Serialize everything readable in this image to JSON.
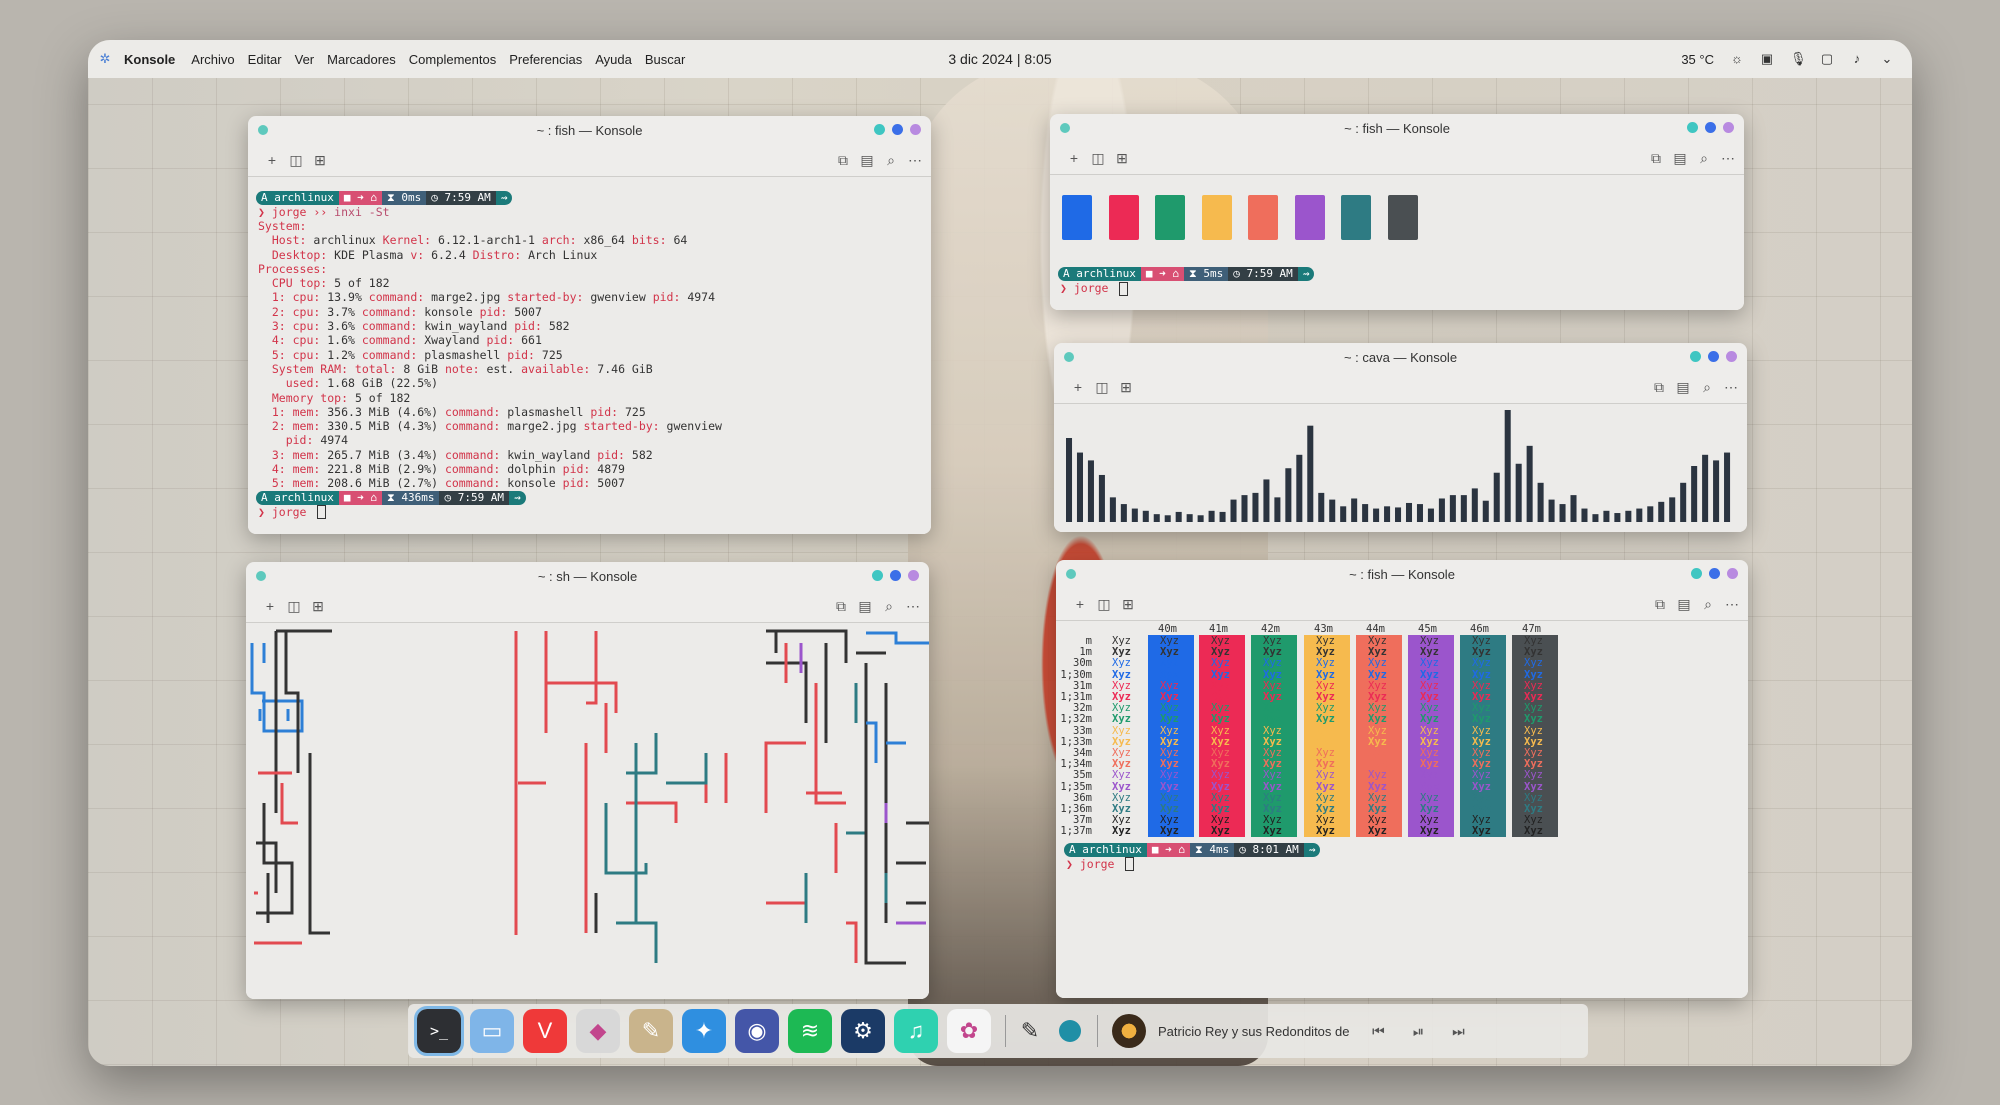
{
  "panel": {
    "app_name": "Konsole",
    "menu": [
      "Archivo",
      "Editar",
      "Ver",
      "Marcadores",
      "Complementos",
      "Preferencias",
      "Ayuda",
      "Buscar"
    ],
    "clock": "3 dic 2024 | 8:05",
    "temperature": "35 °C",
    "tray_icons": [
      "brightness-icon",
      "clipboard-icon",
      "microphone-icon",
      "display-icon",
      "volume-icon",
      "chevron-down-icon"
    ]
  },
  "colors": {
    "blue": "#1f6ae6",
    "red": "#ec2a55",
    "green": "#1f9a6c",
    "yellow": "#f6ba4e",
    "orange": "#ef6e5c",
    "purple": "#9b55cc",
    "teal": "#2e7b83",
    "dark": "#4a4f52",
    "prompt_teal": "#1b7a7a",
    "prompt_dark": "#333f45",
    "prompt_pink": "#d84f73",
    "prompt_blue": "#3f5f78"
  },
  "win1": {
    "title": "~ : fish — Konsole",
    "prompt1": {
      "host": "archlinux",
      "time": "0ms",
      "clock": "7:59 AM"
    },
    "user": "jorge",
    "command": "inxi -St",
    "lines": [
      [
        "System:",
        ""
      ],
      [
        "  Host: ",
        "archlinux ",
        "Kernel: ",
        "6.12.1-arch1-1 ",
        "arch: ",
        "x86_64 ",
        "bits: ",
        "64"
      ],
      [
        "  Desktop: ",
        "KDE Plasma ",
        "v: ",
        "6.2.4 ",
        "Distro: ",
        "Arch Linux"
      ],
      [
        "Processes:",
        ""
      ],
      [
        "  CPU top: ",
        "5 of 182"
      ],
      [
        "  1: cpu: ",
        "13.9% ",
        "command: ",
        "marge2.jpg ",
        "started-by: ",
        "gwenview ",
        "pid: ",
        "4974"
      ],
      [
        "  2: cpu: ",
        "3.7% ",
        "command: ",
        "konsole ",
        "pid: ",
        "5007"
      ],
      [
        "  3: cpu: ",
        "3.6% ",
        "command: ",
        "kwin_wayland ",
        "pid: ",
        "582"
      ],
      [
        "  4: cpu: ",
        "1.6% ",
        "command: ",
        "Xwayland ",
        "pid: ",
        "661"
      ],
      [
        "  5: cpu: ",
        "1.2% ",
        "command: ",
        "plasmashell ",
        "pid: ",
        "725"
      ],
      [
        "  System RAM: total: ",
        "8 GiB ",
        "note: ",
        "est. ",
        "available: ",
        "7.46 GiB"
      ],
      [
        "    used: ",
        "1.68 GiB (22.5%)"
      ],
      [
        "  Memory top: ",
        "5 of 182"
      ],
      [
        "  1: mem: ",
        "356.3 MiB (4.6%) ",
        "command: ",
        "plasmashell ",
        "pid: ",
        "725"
      ],
      [
        "  2: mem: ",
        "330.5 MiB (4.3%) ",
        "command: ",
        "marge2.jpg ",
        "started-by: ",
        "gwenview"
      ],
      [
        "    pid: ",
        "4974"
      ],
      [
        "  3: mem: ",
        "265.7 MiB (3.4%) ",
        "command: ",
        "kwin_wayland ",
        "pid: ",
        "582"
      ],
      [
        "  4: mem: ",
        "221.8 MiB (2.9%) ",
        "command: ",
        "dolphin ",
        "pid: ",
        "4879"
      ],
      [
        "  5: mem: ",
        "208.6 MiB (2.7%) ",
        "command: ",
        "konsole ",
        "pid: ",
        "5007"
      ]
    ],
    "prompt2": {
      "host": "archlinux",
      "time": "436ms",
      "clock": "7:59 AM"
    }
  },
  "win2": {
    "title": "~ : fish — Konsole",
    "prompt": {
      "host": "archlinux",
      "time": "5ms",
      "clock": "7:59 AM"
    },
    "user": "jorge"
  },
  "win3": {
    "title": "~ : cava — Konsole",
    "bars": [
      0.75,
      0.62,
      0.55,
      0.42,
      0.22,
      0.16,
      0.12,
      0.1,
      0.07,
      0.06,
      0.09,
      0.07,
      0.06,
      0.1,
      0.09,
      0.2,
      0.24,
      0.26,
      0.38,
      0.22,
      0.48,
      0.6,
      0.86,
      0.26,
      0.2,
      0.14,
      0.21,
      0.16,
      0.12,
      0.14,
      0.13,
      0.17,
      0.16,
      0.12,
      0.21,
      0.24,
      0.24,
      0.3,
      0.19,
      0.44,
      1.0,
      0.52,
      0.68,
      0.35,
      0.2,
      0.16,
      0.24,
      0.12,
      0.07,
      0.1,
      0.08,
      0.1,
      0.12,
      0.14,
      0.18,
      0.22,
      0.35,
      0.5,
      0.6,
      0.55,
      0.62
    ]
  },
  "win4": {
    "title": "~ : sh — Konsole"
  },
  "win5": {
    "title": "~ : fish — Konsole",
    "col_headers": [
      "40m",
      "41m",
      "42m",
      "43m",
      "44m",
      "45m",
      "46m",
      "47m"
    ],
    "row_labels": [
      "m",
      "1m",
      "30m",
      "1;30m",
      "31m",
      "1;31m",
      "32m",
      "1;32m",
      "33m",
      "1;33m",
      "34m",
      "1;34m",
      "35m",
      "1;35m",
      "36m",
      "1;36m",
      "37m",
      "1;37m"
    ],
    "cell_text": "Xyz",
    "prompt": {
      "host": "archlinux",
      "time": "4ms",
      "clock": "8:01 AM"
    },
    "user": "jorge"
  },
  "dock": {
    "apps": [
      {
        "name": "terminal-app-icon",
        "glyph": ">_",
        "bg": "#2d2f33"
      },
      {
        "name": "files-app-icon",
        "glyph": "▭",
        "bg": "#7fb5e8"
      },
      {
        "name": "vivaldi-app-icon",
        "glyph": "V",
        "bg": "#ef3939"
      },
      {
        "name": "inkscape-app-icon",
        "glyph": "◆",
        "bg": "#d8d8d8"
      },
      {
        "name": "gimp-app-icon",
        "glyph": "✎",
        "bg": "#c9b48c"
      },
      {
        "name": "kdeconnect-app-icon",
        "glyph": "✦",
        "bg": "#2f8fe0"
      },
      {
        "name": "vpn-app-icon",
        "glyph": "◉",
        "bg": "#4456a8"
      },
      {
        "name": "spotify-app-icon",
        "glyph": "≋",
        "bg": "#1db954"
      },
      {
        "name": "steam-app-icon",
        "glyph": "⚙",
        "bg": "#1b3a66"
      },
      {
        "name": "music-app-icon",
        "glyph": "♫",
        "bg": "#2fd1b0"
      },
      {
        "name": "photos-app-icon",
        "glyph": "✿",
        "bg": "#f5f5f5"
      }
    ],
    "media_title": "Patricio Rey y sus Redonditos de"
  }
}
